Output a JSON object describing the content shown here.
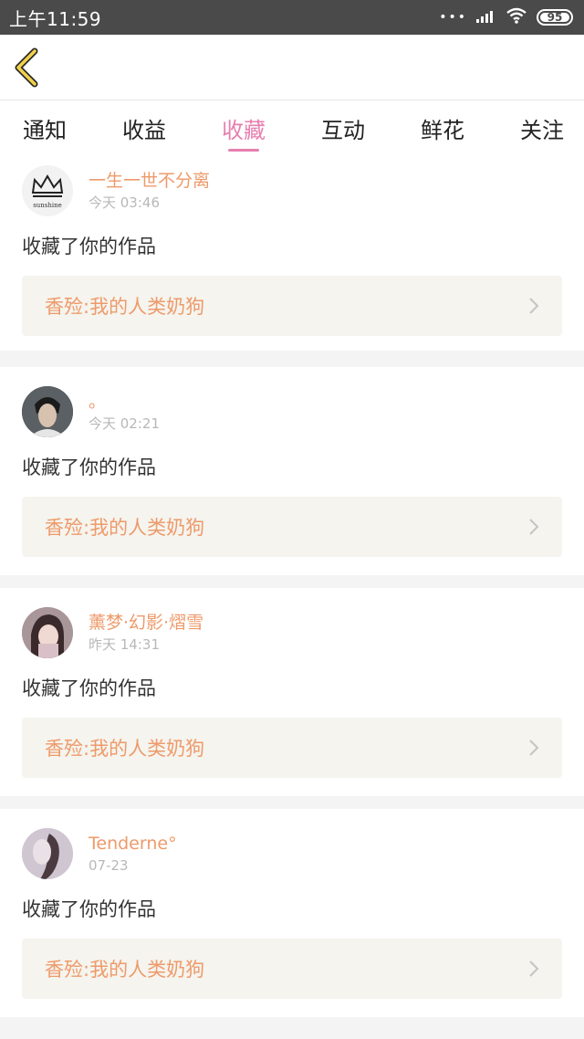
{
  "status_bar": {
    "time": "上午11:59",
    "signal_dots": "•••",
    "battery": "95"
  },
  "tabs": [
    {
      "label": "通知",
      "active": false
    },
    {
      "label": "收益",
      "active": false
    },
    {
      "label": "收藏",
      "active": true
    },
    {
      "label": "互动",
      "active": false
    },
    {
      "label": "鲜花",
      "active": false
    },
    {
      "label": "关注",
      "active": false
    }
  ],
  "colors": {
    "accent_pink": "#e67fb0",
    "accent_orange": "#ee9a6a",
    "status_bar": "#4a4a4a"
  },
  "feed": [
    {
      "user": "一生一世不分离",
      "time": "今天 03:46",
      "action": "收藏了你的作品",
      "work": "香殓:我的人类奶狗",
      "avatar_caption": "sunshine"
    },
    {
      "user": "。",
      "time": "今天 02:21",
      "action": "收藏了你的作品",
      "work": "香殓:我的人类奶狗"
    },
    {
      "user": "薰梦·幻影·熠雪",
      "time": "昨天 14:31",
      "action": "收藏了你的作品",
      "work": "香殓:我的人类奶狗"
    },
    {
      "user": "Tenderne°",
      "time": "07-23",
      "action": "收藏了你的作品",
      "work": "香殓:我的人类奶狗"
    }
  ]
}
